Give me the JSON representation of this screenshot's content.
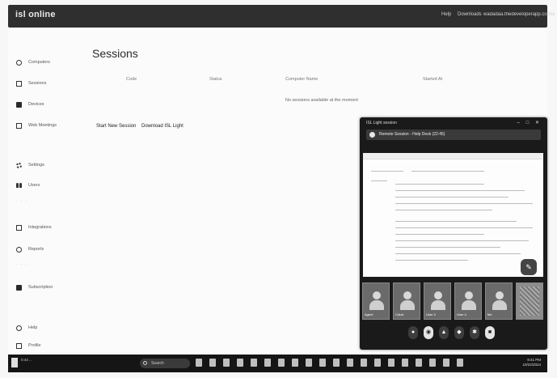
{
  "app": {
    "brand": "isl online",
    "top_nav": [
      "Help",
      "Downloads",
      "wadadaa.thedeveloperapp.com/admin"
    ]
  },
  "sidebar": {
    "items": [
      {
        "label": "Computers",
        "icon": "computer-icon"
      },
      {
        "label": "Sessions",
        "icon": "screen-icon"
      },
      {
        "label": "Devices",
        "icon": "device-icon"
      },
      {
        "label": "Web Meetings",
        "icon": "meeting-icon"
      },
      {
        "label": "Settings",
        "icon": "gear-icon"
      },
      {
        "label": "Users",
        "icon": "users-icon"
      },
      {
        "label": "Integrations",
        "icon": "plug-icon"
      },
      {
        "label": "Reports",
        "icon": "report-icon"
      },
      {
        "label": "Subscription",
        "icon": "card-icon"
      },
      {
        "label": "Help",
        "icon": "help-icon"
      },
      {
        "label": "Profile",
        "icon": "profile-icon"
      }
    ]
  },
  "main": {
    "title": "Sessions",
    "columns": [
      "Code",
      "Status",
      "Computer Name",
      "Started At"
    ],
    "empty_text": "No sessions available at the moment",
    "buttons": {
      "start": "Start New Session",
      "download": "Download ISL Light"
    }
  },
  "remote_window": {
    "title": "ISL Light session",
    "banner": "Remote Session - Help Desk (22:45)",
    "participants": [
      "Agent",
      "Client",
      "User 3",
      "User 4",
      "Me",
      ""
    ],
    "control_icons": [
      "mic-icon",
      "camera-icon",
      "share-icon",
      "chat-icon",
      "settings-icon",
      "end-icon"
    ]
  },
  "taskbar": {
    "search_placeholder": "Search",
    "start_text": "0:43 ...",
    "tray_time": "9:41 PM",
    "tray_date": "10/22/2024"
  }
}
